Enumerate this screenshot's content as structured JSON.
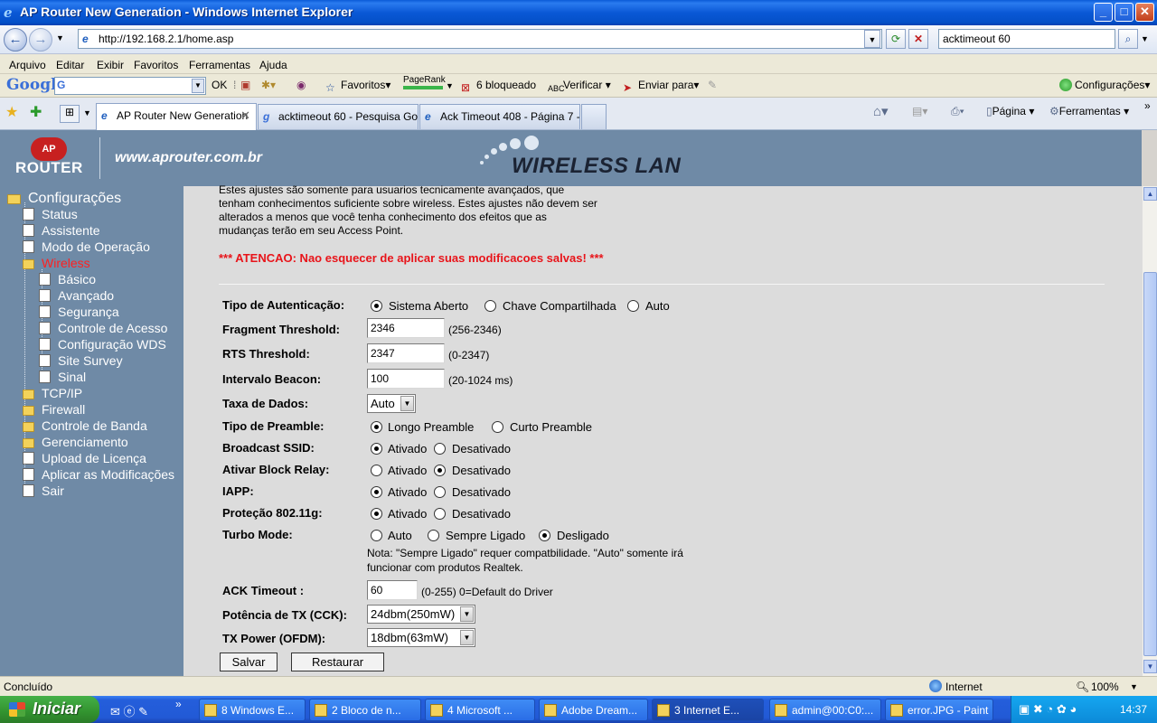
{
  "window": {
    "title": "AP Router New Generation - Windows Internet Explorer",
    "min_label": "_",
    "max_label": "□",
    "close_label": "✕"
  },
  "addressbar": {
    "url": "http://192.168.2.1/home.asp",
    "search_value": "acktimeout 60"
  },
  "menu": [
    "Arquivo",
    "Editar",
    "Exibir",
    "Favoritos",
    "Ferramentas",
    "Ajuda"
  ],
  "google_toolbar": {
    "logo": "Google",
    "ok_label": "OK",
    "favoritos": "Favoritos",
    "pagerank": "PageRank",
    "bloqueado": "6 bloqueado",
    "verificar": "Verificar",
    "enviar": "Enviar para",
    "configuracoes": "Configurações"
  },
  "tabs": [
    {
      "label": "AP Router New Generation",
      "active": true
    },
    {
      "label": "acktimeout 60 - Pesquisa Go...",
      "active": false
    },
    {
      "label": "Ack Timeout 408 - Página 7 - ...",
      "active": false
    }
  ],
  "tab_tools": {
    "pagina": "Página",
    "ferramentas": "Ferramentas"
  },
  "banner": {
    "logo_top": "AP",
    "logo_bottom": "ROUTER",
    "site": "www.aprouter.com.br",
    "product": "WIRELESS LAN"
  },
  "sidebar": {
    "root": "Configurações",
    "items": [
      {
        "label": "Status",
        "type": "doc",
        "level": 1
      },
      {
        "label": "Assistente",
        "type": "doc",
        "level": 1
      },
      {
        "label": "Modo de Operação",
        "type": "doc",
        "level": 1
      },
      {
        "label": "Wireless",
        "type": "folder-open",
        "level": 1,
        "active": true
      },
      {
        "label": "Básico",
        "type": "doc",
        "level": 2
      },
      {
        "label": "Avançado",
        "type": "doc",
        "level": 2
      },
      {
        "label": "Segurança",
        "type": "doc",
        "level": 2
      },
      {
        "label": "Controle de Acesso",
        "type": "doc",
        "level": 2
      },
      {
        "label": "Configuração WDS",
        "type": "doc",
        "level": 2
      },
      {
        "label": "Site Survey",
        "type": "doc",
        "level": 2
      },
      {
        "label": "Sinal",
        "type": "doc",
        "level": 2
      },
      {
        "label": "TCP/IP",
        "type": "folder",
        "level": 1
      },
      {
        "label": "Firewall",
        "type": "folder",
        "level": 1
      },
      {
        "label": "Controle de Banda",
        "type": "folder",
        "level": 1
      },
      {
        "label": "Gerenciamento",
        "type": "folder",
        "level": 1
      },
      {
        "label": "Upload de Licença",
        "type": "doc",
        "level": 1
      },
      {
        "label": "Aplicar as Modificações",
        "type": "doc",
        "level": 1
      },
      {
        "label": "Sair",
        "type": "doc",
        "level": 1
      }
    ]
  },
  "content": {
    "intro": "Estes ajustes são somente para usuarios tecnicamente avançados, que tenham conhecimentos suficiente sobre wireless. Estes ajustes não devem ser alterados a menos que você tenha conhecimento dos efeitos que as mudanças terão em seu Access Point.",
    "warning": "*** ATENCAO: Nao esquecer de aplicar suas modificacoes salvas! ***",
    "auth": {
      "label": "Tipo de Autenticação:",
      "options": [
        "Sistema Aberto",
        "Chave Compartilhada",
        "Auto"
      ],
      "selected": 0
    },
    "fragment": {
      "label": "Fragment Threshold:",
      "value": "2346",
      "hint": "(256-2346)"
    },
    "rts": {
      "label": "RTS Threshold:",
      "value": "2347",
      "hint": "(0-2347)"
    },
    "beacon": {
      "label": "Intervalo Beacon:",
      "value": "100",
      "hint": "(20-1024 ms)"
    },
    "rate": {
      "label": "Taxa de Dados:",
      "value": "Auto"
    },
    "preamble": {
      "label": "Tipo de Preamble:",
      "options": [
        "Longo Preamble",
        "Curto Preamble"
      ],
      "selected": 0
    },
    "broadcast": {
      "label": "Broadcast SSID:",
      "options": [
        "Ativado",
        "Desativado"
      ],
      "selected": 0
    },
    "blockrelay": {
      "label": "Ativar Block Relay:",
      "options": [
        "Ativado",
        "Desativado"
      ],
      "selected": 1
    },
    "iapp": {
      "label": "IAPP:",
      "options": [
        "Ativado",
        "Desativado"
      ],
      "selected": 0
    },
    "protection": {
      "label": "Proteção 802.11g:",
      "options": [
        "Ativado",
        "Desativado"
      ],
      "selected": 0
    },
    "turbo": {
      "label": "Turbo Mode:",
      "options": [
        "Auto",
        "Sempre Ligado",
        "Desligado"
      ],
      "selected": 2
    },
    "turbo_note": "Nota: \"Sempre Ligado\" requer compatbilidade. \"Auto\" somente irá funcionar com produtos Realtek.",
    "ack": {
      "label": "ACK Timeout :",
      "value": "60",
      "hint": "(0-255) 0=Default do Driver"
    },
    "txcck": {
      "label": "Potência de TX (CCK):",
      "value": "24dbm(250mW)"
    },
    "txofdm": {
      "label": "TX Power (OFDM):",
      "value": "18dbm(63mW)"
    },
    "save": "Salvar",
    "reset": "Restaurar"
  },
  "statusbar": {
    "left": "Concluído",
    "zone": "Internet",
    "zoom": "100%"
  },
  "taskbar": {
    "start": "Iniciar",
    "tasks": [
      "8 Windows E...",
      "2 Bloco de n...",
      "4 Microsoft ...",
      "Adobe Dream...",
      "3 Internet E...",
      "admin@00:C0:...",
      "error.JPG - Paint"
    ],
    "active_task": 4,
    "clock": "14:37"
  }
}
